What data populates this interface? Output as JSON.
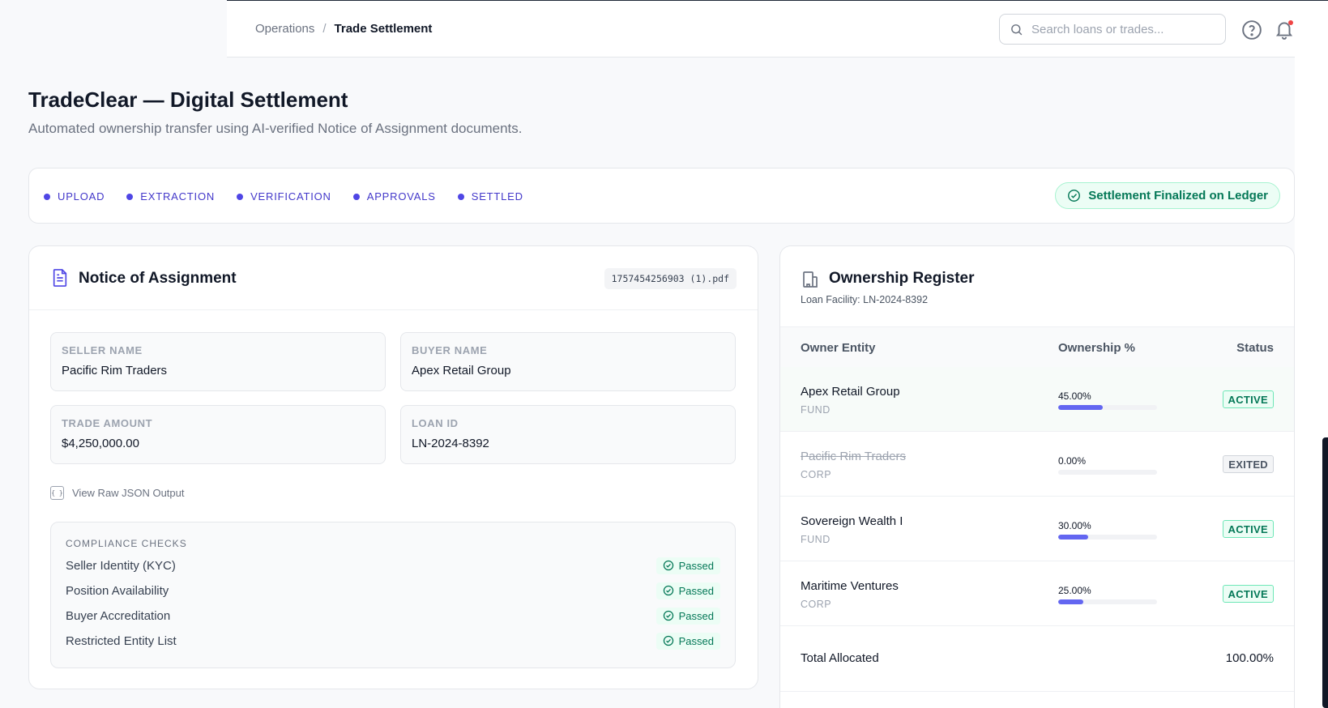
{
  "breadcrumb": {
    "parent": "Operations",
    "separator": "/",
    "current": "Trade Settlement"
  },
  "search": {
    "placeholder": "Search loans or trades..."
  },
  "page": {
    "title": "TradeClear — Digital Settlement",
    "subtitle": "Automated ownership transfer using AI-verified Notice of Assignment documents."
  },
  "stepper": {
    "steps": [
      "UPLOAD",
      "EXTRACTION",
      "VERIFICATION",
      "APPROVALS",
      "SETTLED"
    ],
    "status_badge": "Settlement Finalized on Ledger"
  },
  "notice": {
    "title": "Notice of Assignment",
    "file_name": "1757454256903 (1).pdf",
    "fields": {
      "seller_label": "SELLER NAME",
      "seller_value": "Pacific Rim Traders",
      "buyer_label": "BUYER NAME",
      "buyer_value": "Apex Retail Group",
      "amount_label": "TRADE AMOUNT",
      "amount_value": "$4,250,000.00",
      "loan_label": "LOAN ID",
      "loan_value": "LN-2024-8392"
    },
    "json_icon_text": "{ }",
    "raw_json_label": "View Raw JSON Output",
    "compliance": {
      "title": "COMPLIANCE CHECKS",
      "checks": [
        {
          "label": "Seller Identity (KYC)",
          "status": "Passed"
        },
        {
          "label": "Position Availability",
          "status": "Passed"
        },
        {
          "label": "Buyer Accreditation",
          "status": "Passed"
        },
        {
          "label": "Restricted Entity List",
          "status": "Passed"
        }
      ]
    }
  },
  "register": {
    "title": "Ownership Register",
    "subtitle": "Loan Facility: LN-2024-8392",
    "columns": [
      "Owner Entity",
      "Ownership %",
      "Status"
    ],
    "rows": [
      {
        "name": "Apex Retail Group",
        "type": "FUND",
        "pct": "45.00%",
        "fill": 45,
        "status": "ACTIVE"
      },
      {
        "name": "Pacific Rim Traders",
        "type": "CORP",
        "pct": "0.00%",
        "fill": 0,
        "status": "EXITED"
      },
      {
        "name": "Sovereign Wealth I",
        "type": "FUND",
        "pct": "30.00%",
        "fill": 30,
        "status": "ACTIVE"
      },
      {
        "name": "Maritime Ventures",
        "type": "CORP",
        "pct": "25.00%",
        "fill": 25,
        "status": "ACTIVE"
      }
    ],
    "total_label": "Total Allocated",
    "total_value": "100.00%"
  },
  "colors": {
    "accent": "#4f46e5",
    "success": "#047857",
    "bar_fill": "#6366f1",
    "notification_dot": "#ef4444"
  }
}
